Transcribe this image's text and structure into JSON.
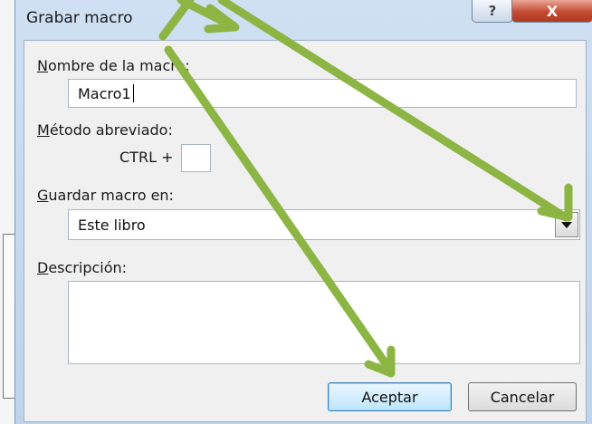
{
  "dialog": {
    "title": "Grabar macro",
    "help_glyph": "?",
    "close_glyph": "X"
  },
  "form": {
    "macro_name_label_accel": "N",
    "macro_name_label_rest": "ombre de la macro:",
    "macro_name_value": "Macro1",
    "shortcut_label_accel": "M",
    "shortcut_label_rest": "étodo abreviado:",
    "ctrl_label": "CTRL +",
    "shortcut_value": "",
    "store_label_accel": "G",
    "store_label_rest": "uardar macro en:",
    "store_selected": "Este libro",
    "description_label_accel": "D",
    "description_label_rest": "escripción:",
    "description_value": ""
  },
  "buttons": {
    "ok": "Aceptar",
    "cancel": "Cancelar"
  },
  "annotation": {
    "arrow_color": "#8cb544"
  }
}
